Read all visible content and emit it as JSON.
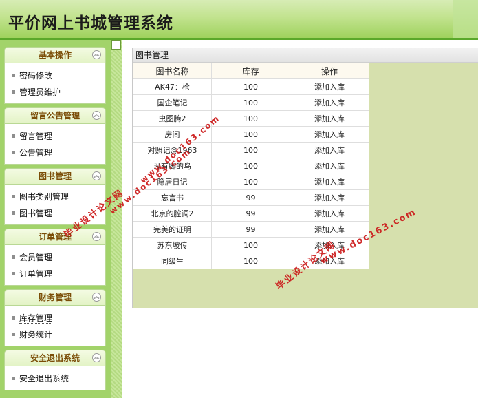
{
  "header": {
    "title": "平价网上书城管理系统"
  },
  "sidebar": {
    "panels": [
      {
        "title": "基本操作",
        "items": [
          "密码修改",
          "管理员维护"
        ]
      },
      {
        "title": "留言公告管理",
        "items": [
          "留言管理",
          "公告管理"
        ]
      },
      {
        "title": "图书管理",
        "items": [
          "图书类别管理",
          "图书管理"
        ]
      },
      {
        "title": "订单管理",
        "items": [
          "会员管理",
          "订单管理"
        ]
      },
      {
        "title": "财务管理",
        "items": [
          "库存管理",
          "财务统计"
        ]
      },
      {
        "title": "安全退出系统",
        "items": [
          "安全退出系统"
        ]
      }
    ],
    "collapse_icon": "chevron-up-double-icon"
  },
  "main": {
    "caption": "图书管理",
    "columns": [
      "图书名称",
      "库存",
      "操作"
    ],
    "rows": [
      {
        "name": "AK47：枪",
        "stock": "100",
        "action": "添加入库"
      },
      {
        "name": "国企笔记",
        "stock": "100",
        "action": "添加入库"
      },
      {
        "name": "虫图腾2",
        "stock": "100",
        "action": "添加入库"
      },
      {
        "name": "房间",
        "stock": "100",
        "action": "添加入库"
      },
      {
        "name": "对照记@1963",
        "stock": "100",
        "action": "添加入库"
      },
      {
        "name": "没有脚的鸟",
        "stock": "100",
        "action": "添加入库"
      },
      {
        "name": "隐居日记",
        "stock": "100",
        "action": "添加入库"
      },
      {
        "name": "忘言书",
        "stock": "99",
        "action": "添加入库"
      },
      {
        "name": "北京的腔调2",
        "stock": "99",
        "action": "添加入库"
      },
      {
        "name": "完美的证明",
        "stock": "99",
        "action": "添加入库"
      },
      {
        "name": "苏东坡传",
        "stock": "100",
        "action": "添加入库"
      },
      {
        "name": "同级生",
        "stock": "100",
        "action": "添加入库"
      }
    ]
  },
  "watermark": {
    "site": "www.doc163.com",
    "text": "毕业设计论文网"
  },
  "colors": {
    "sidebar_bg": "#a2d36a",
    "header_border": "#5aa82a",
    "panel_title": "#7b4d07",
    "table_bg_right": "#d6e0ad",
    "watermark": "#cc1a1a"
  }
}
